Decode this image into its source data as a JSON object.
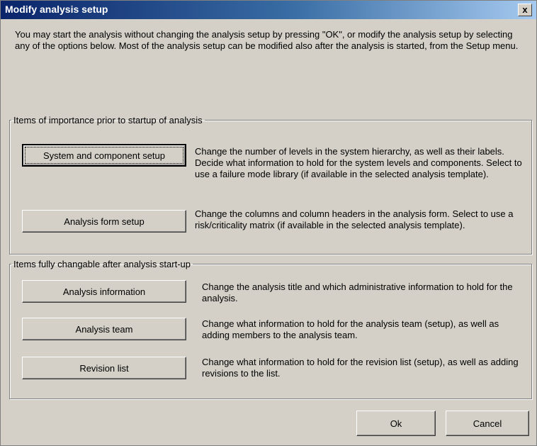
{
  "window": {
    "title": "Modify analysis setup",
    "close_glyph": "x"
  },
  "intro": "You may start the analysis without changing the analysis setup by pressing \"OK\", or modify the analysis setup by selecting any of the options below. Most of the analysis setup can be modified also after the analysis is started, from the Setup menu.",
  "group1": {
    "legend": "Items of importance prior to startup of analysis",
    "items": [
      {
        "button": "System and component setup",
        "description": "Change the number of levels in the system hierarchy, as well as their labels. Decide what information to hold for the system levels and components. Select to use a failure mode library (if available in the selected analysis template)."
      },
      {
        "button": "Analysis form setup",
        "description": "Change the columns and column headers in the analysis form. Select to use a risk/criticality matrix (if available in the selected analysis template)."
      }
    ]
  },
  "group2": {
    "legend": "Items fully changable after analysis start-up",
    "items": [
      {
        "button": "Analysis information",
        "description": "Change the analysis title and which administrative information to hold for the analysis."
      },
      {
        "button": "Analysis team",
        "description": "Change what information to hold for the analysis team (setup), as well as adding members to the analysis team."
      },
      {
        "button": "Revision list",
        "description": "Change what information to hold for the revision list (setup), as well as adding revisions to the list."
      }
    ]
  },
  "footer": {
    "ok_label": "Ok",
    "cancel_label": "Cancel"
  }
}
